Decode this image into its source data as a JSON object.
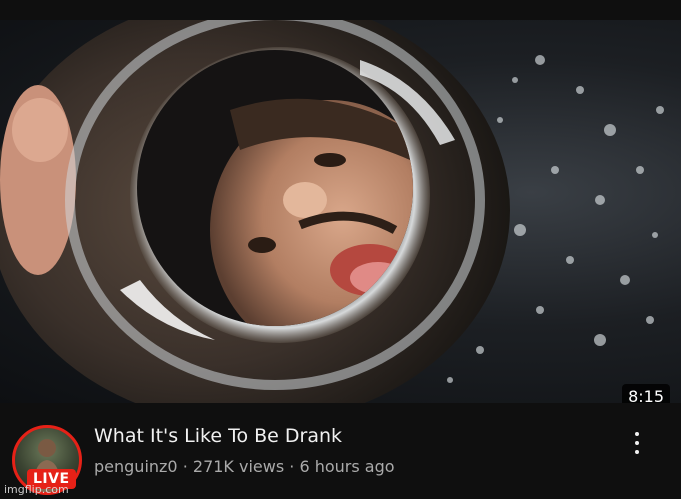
{
  "video": {
    "duration": "8:15",
    "title": "What It's Like To Be Drank",
    "channel": "penguinz0",
    "separator": "·",
    "views": "271K views",
    "age": "6 hours ago",
    "live_label": "LIVE"
  },
  "colors": {
    "background": "#0f0f0f",
    "live_red": "#e62117",
    "secondary_text": "#aaaaaa"
  },
  "icons": [
    "more-vert-icon"
  ],
  "watermark": "imgflip.com"
}
